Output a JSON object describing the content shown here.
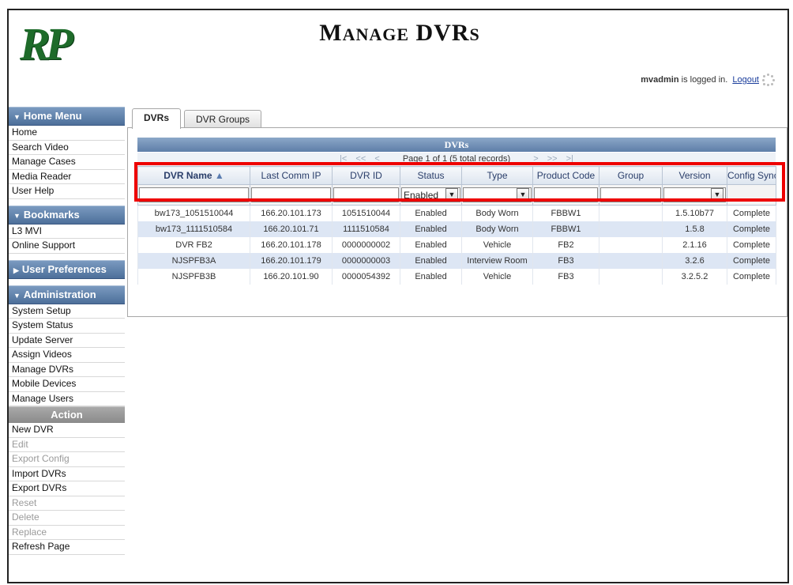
{
  "header": {
    "logo_text": "RP",
    "title_first": "M",
    "title_rest": "ANAGE",
    "title_second_first": "DVR",
    "title_second_rest": "S",
    "user": "mvadmin",
    "logged_in_text": "is logged in.",
    "logout_label": "Logout"
  },
  "sidebar": {
    "home_menu": {
      "title": "Home Menu",
      "items": [
        "Home",
        "Search Video",
        "Manage Cases",
        "Media Reader",
        "User Help"
      ]
    },
    "bookmarks": {
      "title": "Bookmarks",
      "items": [
        "L3 MVI",
        "Online Support"
      ]
    },
    "user_preferences": {
      "title": "User Preferences"
    },
    "administration": {
      "title": "Administration",
      "items": [
        "System Setup",
        "System Status",
        "Update Server",
        "Assign Videos",
        "Manage DVRs",
        "Mobile Devices",
        "Manage Users"
      ]
    },
    "action": {
      "title": "Action",
      "items": [
        {
          "label": "New DVR",
          "enabled": true
        },
        {
          "label": "Edit",
          "enabled": false
        },
        {
          "label": "Export Config",
          "enabled": false
        },
        {
          "label": "Import DVRs",
          "enabled": true
        },
        {
          "label": "Export DVRs",
          "enabled": true
        },
        {
          "label": "Reset",
          "enabled": false
        },
        {
          "label": "Delete",
          "enabled": false
        },
        {
          "label": "Replace",
          "enabled": false
        },
        {
          "label": "Refresh Page",
          "enabled": true
        }
      ]
    }
  },
  "tabs": [
    {
      "label": "DVRs",
      "active": true
    },
    {
      "label": "DVR Groups",
      "active": false
    }
  ],
  "grid": {
    "title": "DVRs",
    "pager_text": "Page 1 of 1 (5 total records)",
    "columns": [
      "DVR Name",
      "Last Comm IP",
      "DVR ID",
      "Status",
      "Type",
      "Product Code",
      "Group",
      "Version",
      "Config Sync"
    ],
    "sort_indicator": "▲",
    "filters": {
      "status_value": "Enabled",
      "type_value": "",
      "version_value": ""
    },
    "rows": [
      [
        "bw173_1051510044",
        "166.20.101.173",
        "1051510044",
        "Enabled",
        "Body Worn",
        "FBBW1",
        "",
        "1.5.10b77",
        "Complete"
      ],
      [
        "bw173_1111510584",
        "166.20.101.71",
        "1111510584",
        "Enabled",
        "Body Worn",
        "FBBW1",
        "",
        "1.5.8",
        "Complete"
      ],
      [
        "DVR FB2",
        "166.20.101.178",
        "0000000002",
        "Enabled",
        "Vehicle",
        "FB2",
        "",
        "2.1.16",
        "Complete"
      ],
      [
        "NJSPFB3A",
        "166.20.101.179",
        "0000000003",
        "Enabled",
        "Interview Room",
        "FB3",
        "",
        "3.2.6",
        "Complete"
      ],
      [
        "NJSPFB3B",
        "166.20.101.90",
        "0000054392",
        "Enabled",
        "Vehicle",
        "FB3",
        "",
        "3.2.5.2",
        "Complete"
      ]
    ]
  },
  "icons": {
    "first": "|<",
    "prev_fast": "<<",
    "prev": "<",
    "next": ">",
    "next_fast": ">>",
    "last": ">|"
  },
  "colors": {
    "accent_red": "#e00000",
    "logo_green": "#1e6b2a",
    "menu_blue": "#4d6f9a"
  }
}
